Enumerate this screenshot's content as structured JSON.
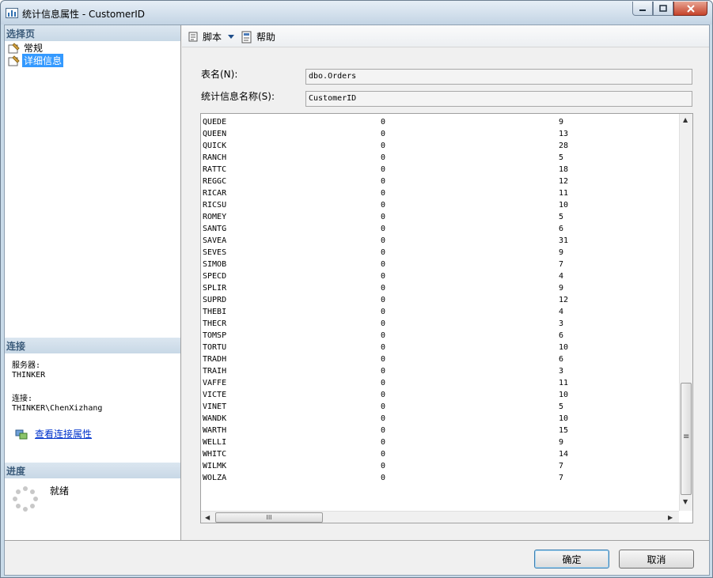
{
  "window": {
    "title": "统计信息属性 - CustomerID"
  },
  "left": {
    "select_page_header": "选择页",
    "nav": [
      {
        "label": "常规",
        "selected": false
      },
      {
        "label": "详细信息",
        "selected": true
      }
    ],
    "connection_header": "连接",
    "server_label": "服务器:",
    "server_value": "THINKER",
    "conn_label": "连接:",
    "conn_value": "THINKER\\ChenXizhang",
    "view_conn_props": "查看连接属性",
    "progress_header": "进度",
    "progress_status": "就绪"
  },
  "toolbar": {
    "script": "脚本",
    "help": "帮助"
  },
  "form": {
    "table_label": "表名(N):",
    "table_value": "dbo.Orders",
    "stat_label": "统计信息名称(S):",
    "stat_value": "CustomerID"
  },
  "grid": {
    "rows": [
      [
        "QUEDE",
        "0",
        "9"
      ],
      [
        "QUEEN",
        "0",
        "13"
      ],
      [
        "QUICK",
        "0",
        "28"
      ],
      [
        "RANCH",
        "0",
        "5"
      ],
      [
        "RATTC",
        "0",
        "18"
      ],
      [
        "REGGC",
        "0",
        "12"
      ],
      [
        "RICAR",
        "0",
        "11"
      ],
      [
        "RICSU",
        "0",
        "10"
      ],
      [
        "ROMEY",
        "0",
        "5"
      ],
      [
        "SANTG",
        "0",
        "6"
      ],
      [
        "SAVEA",
        "0",
        "31"
      ],
      [
        "SEVES",
        "0",
        "9"
      ],
      [
        "SIMOB",
        "0",
        "7"
      ],
      [
        "SPECD",
        "0",
        "4"
      ],
      [
        "SPLIR",
        "0",
        "9"
      ],
      [
        "SUPRD",
        "0",
        "12"
      ],
      [
        "THEBI",
        "0",
        "4"
      ],
      [
        "THECR",
        "0",
        "3"
      ],
      [
        "TOMSP",
        "0",
        "6"
      ],
      [
        "TORTU",
        "0",
        "10"
      ],
      [
        "TRADH",
        "0",
        "6"
      ],
      [
        "TRAIH",
        "0",
        "3"
      ],
      [
        "VAFFE",
        "0",
        "11"
      ],
      [
        "VICTE",
        "0",
        "10"
      ],
      [
        "VINET",
        "0",
        "5"
      ],
      [
        "WANDK",
        "0",
        "10"
      ],
      [
        "WARTH",
        "0",
        "15"
      ],
      [
        "WELLI",
        "0",
        "9"
      ],
      [
        "WHITC",
        "0",
        "14"
      ],
      [
        "WILMK",
        "0",
        "7"
      ],
      [
        "WOLZA",
        "0",
        "7"
      ]
    ],
    "vscroll_position": 0.88,
    "hscroll_grip": "III",
    "vscroll_grip": "≡"
  },
  "buttons": {
    "ok": "确定",
    "cancel": "取消"
  },
  "icons": [
    "chart-icon",
    "minimize-icon",
    "maximize-icon",
    "close-icon",
    "page-icon",
    "script-icon",
    "dropdown-arrow-icon",
    "help-icon",
    "connection-icon",
    "spinner-icon"
  ]
}
